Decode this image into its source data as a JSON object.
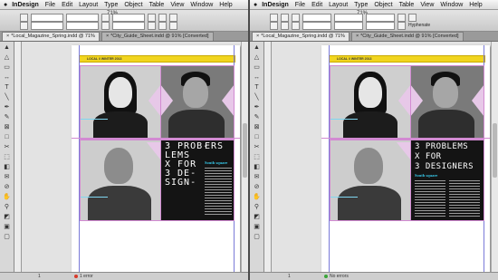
{
  "menubar": {
    "app_name": "InDesign",
    "items": [
      "File",
      "Edit",
      "Layout",
      "Type",
      "Object",
      "Table",
      "View",
      "Window",
      "Help"
    ]
  },
  "left": {
    "zoom": "71%",
    "tabs": [
      {
        "label": "*Local_Magazine_Spring.indd @ 71%",
        "active": true
      },
      {
        "label": "*City_Guide_Sheet.indd @ 91% [Converted]",
        "active": false
      }
    ],
    "folio": "LOCAL // WINTER 2013",
    "headline": "3 PROB-\nLEMS\nX FOR\n3 DE-\nSIGN-",
    "headline_right": "ERS",
    "subhead": "South square",
    "page_number": "1",
    "status_errors": "1 error",
    "status_color": "#d83a2c"
  },
  "right": {
    "zoom": "71%",
    "tabs": [
      {
        "label": "*Local_Magazine_Spring.indd @ 71%",
        "active": true
      },
      {
        "label": "*City_Guide_Sheet.indd @ 91% [Converted]",
        "active": false
      }
    ],
    "folio": "LOCAL // WINTER 2013",
    "headline": "3 PROBLEMS\nX FOR\n3 DESIGNERS",
    "subhead": "South square",
    "page_number": "1",
    "status_errors": "No errors",
    "status_color": "#3aa63a",
    "hyphenate_label": "Hyphenate"
  },
  "colors": {
    "accent_cyan": "#36c6e6",
    "frame_pink": "#d28ad2",
    "folio_yellow": "#f1d51f"
  }
}
